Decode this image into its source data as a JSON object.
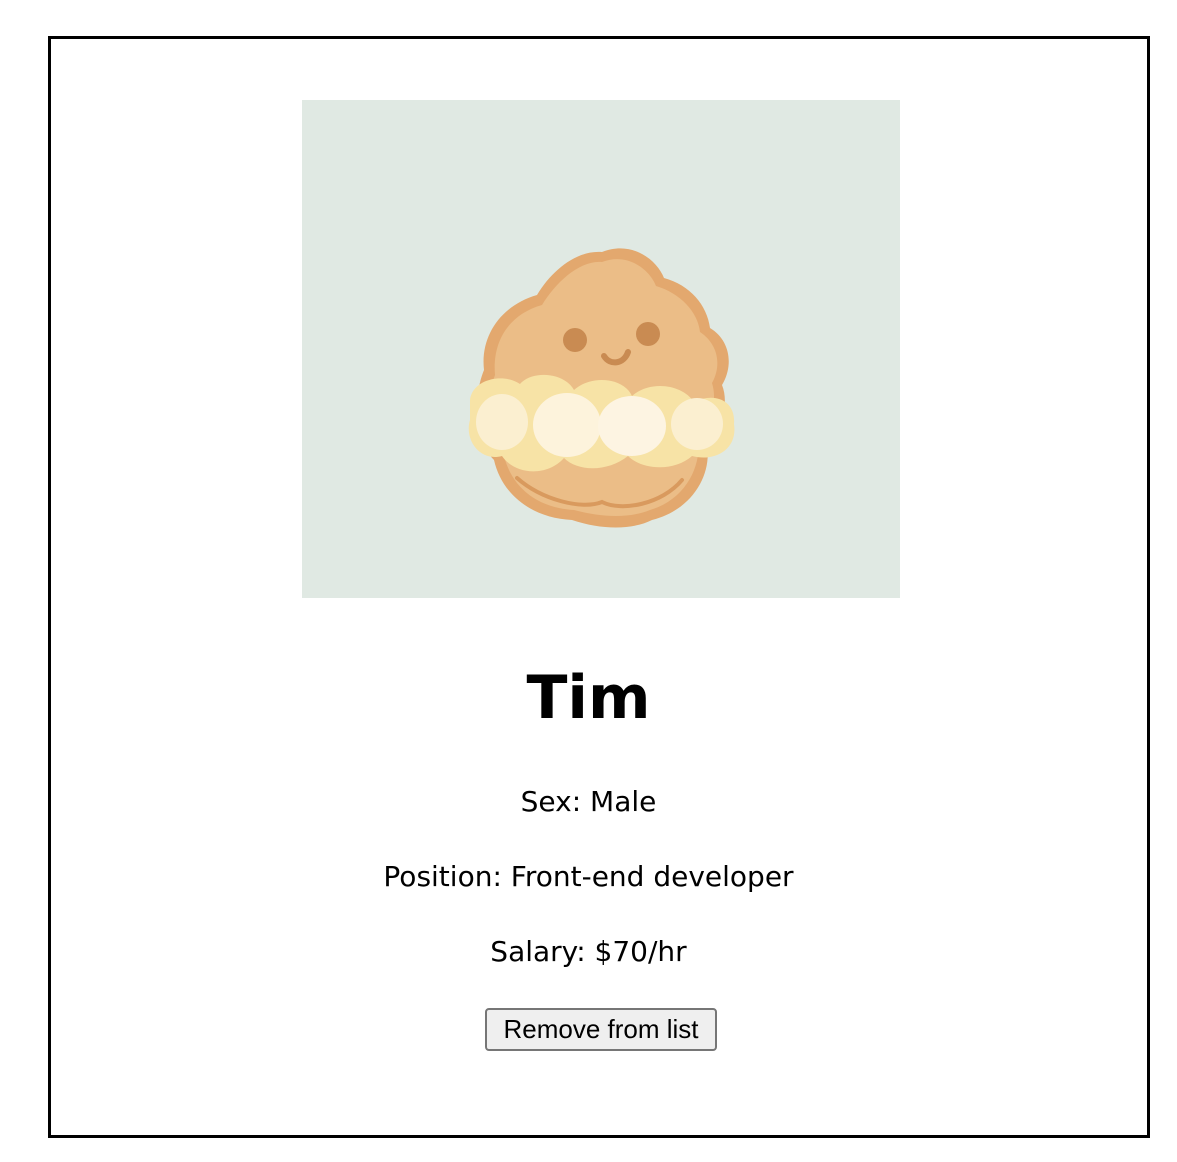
{
  "profile": {
    "name": "Tim",
    "sex": "Sex: Male",
    "position": "Position: Front-end developer",
    "salary": "Salary: $70/hr"
  },
  "actions": {
    "remove_label": "Remove from list"
  },
  "image": {
    "icon": "nugget-character-illustration",
    "background_color": "#e0e9e3"
  }
}
